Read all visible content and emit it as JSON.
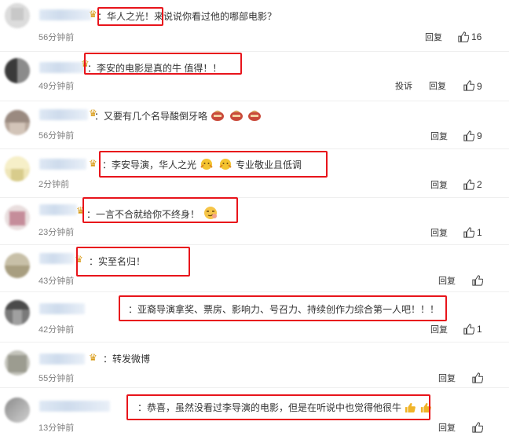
{
  "comments": [
    {
      "text": "：华人之光！来说说你看过他的哪部电影？",
      "time": "56分钟前",
      "reply": "回复",
      "likes": "16"
    },
    {
      "text": "：李安的电影是真的牛 值得！！",
      "time": "49分钟前",
      "report": "投诉",
      "reply": "回复",
      "likes": "9"
    },
    {
      "text": "：又要有几个名导酸倒牙咯",
      "time": "56分钟前",
      "reply": "回复",
      "likes": "9"
    },
    {
      "text_a": "：李安导演，华人之光",
      "text_b": "专业敬业且低调",
      "time": "2分钟前",
      "reply": "回复",
      "likes": "2"
    },
    {
      "text": "：一言不合就给你不终身！",
      "time": "23分钟前",
      "reply": "回复",
      "likes": "1"
    },
    {
      "text": "：实至名归！",
      "time": "43分钟前",
      "reply": "回复",
      "likes": ""
    },
    {
      "text": "：亚裔导演拿奖、票房、影响力、号召力、持续创作力综合第一人吧！！！",
      "time": "42分钟前",
      "reply": "回复",
      "likes": "1"
    },
    {
      "text": "：转发微博",
      "time": "55分钟前",
      "reply": "回复",
      "likes": ""
    },
    {
      "text": "：恭喜，虽然没看过李导演的电影，但是在听说中也觉得他很牛",
      "time": "13分钟前",
      "reply": "回复",
      "likes": ""
    }
  ],
  "colors": {
    "highlight_box": "#e8141b",
    "text": "#333333",
    "muted": "#808080",
    "badge": "#d89a14"
  }
}
